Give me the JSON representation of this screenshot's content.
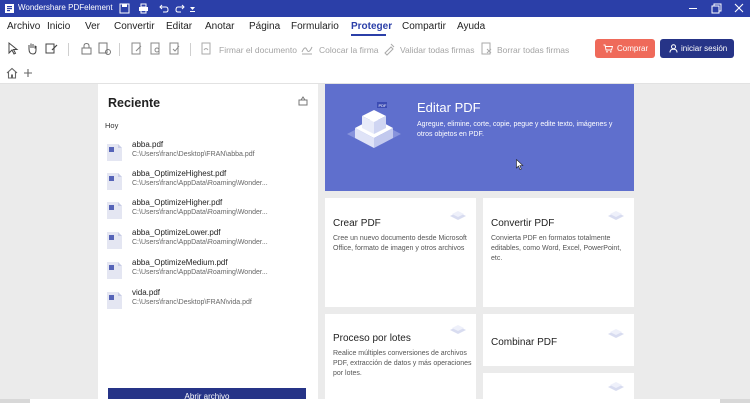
{
  "window": {
    "title": "Wondershare PDFelement"
  },
  "menu": {
    "items": [
      {
        "label": "Archivo"
      },
      {
        "label": "Inicio"
      },
      {
        "label": "Ver"
      },
      {
        "label": "Convertir"
      },
      {
        "label": "Editar"
      },
      {
        "label": "Anotar"
      },
      {
        "label": "Página"
      },
      {
        "label": "Formulario"
      },
      {
        "label": "Proteger"
      },
      {
        "label": "Compartir"
      },
      {
        "label": "Ayuda"
      }
    ],
    "active": "Proteger"
  },
  "toolbar": {
    "sign_document": "Firmar el documento",
    "place_signature": "Colocar la firma",
    "validate_signatures": "Validar todas firmas",
    "delete_signatures": "Borrar todas firmas",
    "buy_label": "Comprar",
    "login_label": "iniciar sesión"
  },
  "recent": {
    "title": "Reciente",
    "group": "Hoy",
    "files": [
      {
        "name": "abba.pdf",
        "path": "C:\\Users\\franc\\Desktop\\FRAN\\abba.pdf"
      },
      {
        "name": "abba_OptimizeHighest.pdf",
        "path": "C:\\Users\\franc\\AppData\\Roaming\\Wonder..."
      },
      {
        "name": "abba_OptimizeHigher.pdf",
        "path": "C:\\Users\\franc\\AppData\\Roaming\\Wonder..."
      },
      {
        "name": "abba_OptimizeLower.pdf",
        "path": "C:\\Users\\franc\\AppData\\Roaming\\Wonder..."
      },
      {
        "name": "abba_OptimizeMedium.pdf",
        "path": "C:\\Users\\franc\\AppData\\Roaming\\Wonder..."
      },
      {
        "name": "vida.pdf",
        "path": "C:\\Users\\franc\\Desktop\\FRAN\\vida.pdf"
      }
    ],
    "open_button": "Abrir archivo"
  },
  "cards": {
    "edit": {
      "title": "Editar PDF",
      "desc": "Agregue, elimine, corte, copie, pegue y edite texto, imágenes y otros objetos en PDF."
    },
    "create": {
      "title": "Crear PDF",
      "desc": "Cree un nuevo documento desde Microsoft Office, formato de imagen y otros archivos"
    },
    "convert": {
      "title": "Convertir PDF",
      "desc": "Convierta PDF en formatos totalmente editables, como Word, Excel, PowerPoint, etc."
    },
    "batch": {
      "title": "Proceso por lotes",
      "desc": "Realice múltiples conversiones de archivos PDF, extracción de datos y más operaciones por lotes."
    },
    "combine": {
      "title": "Combinar PDF"
    }
  },
  "colors": {
    "titlebar": "#2b3fa8",
    "accent": "#263487",
    "edit_card": "#5f6fcd",
    "buy": "#ef6a5a"
  },
  "icons": [
    "logo-icon",
    "save-icon",
    "print-icon",
    "undo-icon",
    "redo-icon",
    "minimize-icon",
    "maximize-icon",
    "close-icon",
    "home-icon",
    "plus-icon",
    "pin-icon",
    "pdf-file-icon",
    "cart-icon",
    "user-icon"
  ]
}
